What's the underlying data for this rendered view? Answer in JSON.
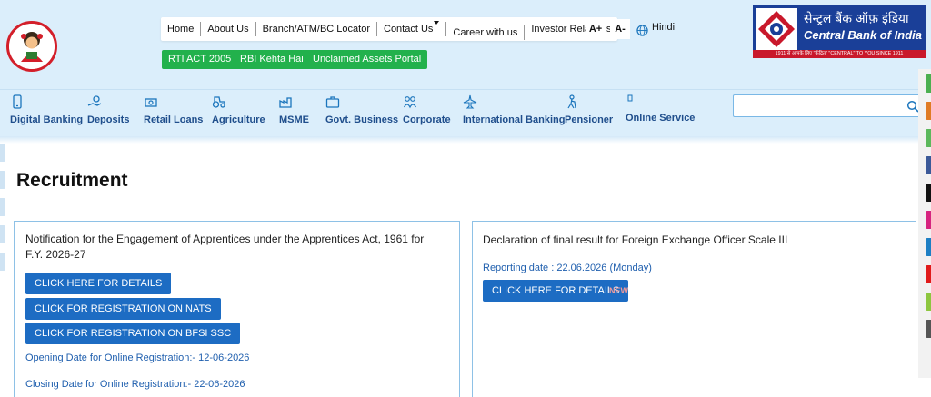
{
  "header": {
    "left_logo_icon": "girl-child-logo-icon",
    "top_nav": [
      "Home",
      "About Us",
      "Branch/ATM/BC Locator",
      "Contact Us",
      "Career with us",
      "Investor Relations"
    ],
    "font_increase": "A+",
    "font_decrease": "A-",
    "language": "Hindi",
    "quick_links": [
      "RTI ACT 2005",
      "RBI Kehta Hai",
      "Unclaimed Assets Portal"
    ],
    "bank_name_hindi": "सेन्ट्रल बैंक ऑफ़ इंडिया",
    "bank_name_english": "Central Bank of India",
    "tagline": "1911 से आपके लिए \"केंद्रित\" \"CENTRAL\" TO YOU SINCE 1911"
  },
  "main_nav": [
    {
      "label": "Digital Banking",
      "icon": "mobile-icon"
    },
    {
      "label": "Deposits",
      "icon": "hand-coin-icon"
    },
    {
      "label": "Retail Loans",
      "icon": "loan-icon"
    },
    {
      "label": "Agriculture",
      "icon": "tractor-icon"
    },
    {
      "label": "MSME",
      "icon": "factory-icon"
    },
    {
      "label": "Govt. Business",
      "icon": "briefcase-icon"
    },
    {
      "label": "Corporate",
      "icon": "people-icon"
    },
    {
      "label": "International Banking",
      "icon": "airplane-icon"
    },
    {
      "label": "Pensioner",
      "icon": "pensioner-icon"
    },
    {
      "label": "Online Service",
      "icon": "online-icon"
    }
  ],
  "search": {
    "placeholder": "",
    "value": "",
    "icon": "search-icon"
  },
  "page_title": "Recruitment",
  "cards": [
    {
      "title": "Notification for the Engagement of Apprentices under the Apprentices Act, 1961 for F.Y. 2026-27",
      "buttons": [
        "CLICK HERE FOR DETAILS",
        "CLICK FOR REGISTRATION ON NATS",
        "CLICK FOR REGISTRATION ON BFSI SSC"
      ],
      "opening": "Opening Date for Online Registration:- 12-06-2026",
      "closing": "Closing Date for Online Registration:- 22-06-2026"
    },
    {
      "title": "Declaration of final result for Foreign Exchange Officer Scale III",
      "reporting": "Reporting date : 22.06.2026 (Monday)",
      "button": "CLICK HERE FOR DETAILS",
      "badge": "NEW"
    }
  ],
  "colors": {
    "header_bg": "#dbeefb",
    "green": "#22b14c",
    "button_blue": "#1d6cc3",
    "link_blue": "#1f5fae",
    "logo_blue": "#1a3f98",
    "logo_red": "#c9182b"
  },
  "right_rail_colors": [
    "#4caf50",
    "#e07b24",
    "#5cb85c",
    "#3b5998",
    "#111111",
    "#d6247f",
    "#1d7fc4",
    "#e01b1b",
    "#8dc63f",
    "#555555"
  ]
}
